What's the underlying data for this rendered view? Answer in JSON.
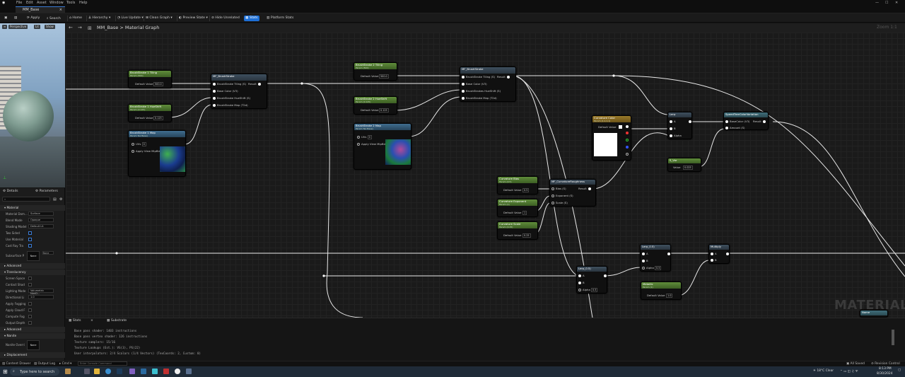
{
  "menu": [
    "File",
    "Edit",
    "Asset",
    "Window",
    "Tools",
    "Help"
  ],
  "tab": {
    "title": "MM_Base"
  },
  "toolbar": {
    "apply": "Apply",
    "search": "Search",
    "home": "Home",
    "hierarchy": "Hierarchy",
    "live_update": "Live Update",
    "clean_graph": "Clean Graph",
    "preview_state": "Preview State",
    "hide_unrelated": "Hide Unrelated",
    "stats": "Stats",
    "platform_stats": "Platform Stats"
  },
  "viewport": {
    "perspective": "Perspective",
    "lit": "Lit",
    "show": "Show"
  },
  "details": {
    "tab_details": "Details",
    "tab_parameters": "Parameters",
    "sections": {
      "material": "Material",
      "advanced": "Advanced",
      "translucency": "Translucency",
      "advanced2": "Advanced",
      "nanite": "Nanite",
      "displacement": "Displacement"
    },
    "rows": [
      {
        "label": "Material Dom...",
        "value": "Surface"
      },
      {
        "label": "Blend Mode",
        "value": "Opaque"
      },
      {
        "label": "Shading Model",
        "value": "Default Lit"
      },
      {
        "label": "Two Sided",
        "value": ""
      },
      {
        "label": "Use Material",
        "value": ""
      },
      {
        "label": "Cast Ray Tra",
        "value": ""
      }
    ],
    "subsurface_label": "Subsurface P",
    "none_label": "None",
    "trans_rows": [
      "Screen Space",
      "Contact Shad",
      "Lighting Mode",
      "Directional Li",
      "Apply Fogging",
      "Apply Cloud F",
      "Compute Fog",
      "Output Depth"
    ],
    "lighting_mode_value": "Volumetric NonD...",
    "directional_value": "1.0",
    "nanite_label": "Nanite Overri",
    "nanite_value": "None"
  },
  "graph": {
    "breadcrumb_root": "MM_Base",
    "breadcrumb_sep": ">",
    "breadcrumb_leaf": "Material Graph",
    "zoom": "Zoom 1:1",
    "watermark": "MATERIAL"
  },
  "nodes": {
    "bs1_tiling": {
      "title": "BrushStroke 1 Tiling",
      "sub": "Param (500)",
      "label": "Default Value",
      "value": "500.0"
    },
    "bs1_hueshift": {
      "title": "BrushStroke 1 HueShift",
      "sub": "Param (0.125)",
      "label": "Default Value",
      "value": "0.125"
    },
    "bs1_map": {
      "title": "BrushStroke 1 Map",
      "sub": "Param Tex Base)",
      "uvs": "UVs",
      "uvs_val": "0",
      "apply": "Apply View MipBias"
    },
    "mf_bs1": {
      "title": "MF_BrushStroke",
      "result": "Result",
      "pins": [
        "BrushStroke Tiling (S)",
        "Base Color (V3)",
        "BrushStroke HueShift (S)",
        "BrushStroke Map (T2d)"
      ]
    },
    "bs2_tiling": {
      "title": "BrushStroke 2 Tiling",
      "sub": "Param (500)",
      "label": "Default Value",
      "value": "500.0"
    },
    "bs2_hueshift": {
      "title": "BrushStroke 2 HueShift",
      "sub": "Param (0.125)",
      "label": "Default Value",
      "value": "0.125"
    },
    "bs2_map": {
      "title": "BrushStroke 2 Map",
      "sub": "Param Tex Base)",
      "uvs": "UVs",
      "uvs_val": "0",
      "apply": "Apply View MipBias"
    },
    "mf_bs2": {
      "title": "MF_BrushStroke",
      "result": "Result",
      "pins": [
        "BrushStroke Tiling (S)",
        "Base Color (V3)",
        "BrushStrokes HueShift (S)",
        "BrushStroke Map (T2d)"
      ]
    },
    "curv_color": {
      "title": "Curvature Color",
      "sub": "Param (1,1,1,1)",
      "label": "Default Value"
    },
    "lerp1": {
      "title": "Lerp",
      "a": "A",
      "b": "B",
      "alpha": "Alpha"
    },
    "speed_tree": {
      "title": "SpeedTreeColorVariation",
      "result": "Result",
      "base": "BaseColor (V3)",
      "amount": "Amount (S)"
    },
    "s_param": {
      "title": "S_Var",
      "label": "Value",
      "value": "0.025"
    },
    "curv_bias": {
      "title": "Curvature Bias",
      "sub": "Param (0.5)",
      "label": "Default Value",
      "value": "0.5"
    },
    "curv_exp": {
      "title": "Curvature Exponent",
      "sub": "Param (1)",
      "label": "Default Value",
      "value": "1"
    },
    "curv_scale": {
      "title": "Curvature Scale",
      "sub": "Param (0.25)",
      "label": "Default Value",
      "value": "0.25"
    },
    "mf_curv": {
      "title": "MF_CurvatureRoughness",
      "result": "Result",
      "pins": [
        "Bias (S)",
        "Exponent (S)",
        "Scale (S)"
      ]
    },
    "lerp2": {
      "title": "Lerp_0.5)",
      "a": "A",
      "b": "B",
      "alpha": "Alpha",
      "alpha_val": "0.5"
    },
    "lerp3": {
      "title": "Lerp_0.5)",
      "a": "A",
      "b": "B",
      "alpha": "Alpha",
      "alpha_val": "0.5"
    },
    "multiply": {
      "title": "Multiply",
      "a": "A",
      "b": "B"
    },
    "metallic": {
      "title": "Metallic",
      "sub": "Param (1)",
      "label": "Default Value",
      "value": "1.0"
    },
    "corner": {
      "title": "Name"
    }
  },
  "stats": {
    "tab_stats": "Stats",
    "tab_substrate": "Substrate",
    "lines": [
      "Base pass shader: 1403 instructions",
      "Base pass vertex shader: 126 instructions",
      "Texture samplers: 15/16",
      "Texture Lookups (Est.): VS(3), PS(22)",
      "User interpolators: 2/4 Scalars (1/4 Vectors) (TexCoords: 2, Custom: 0)"
    ]
  },
  "bottom": {
    "content_drawer": "Content Drawer",
    "output_log": "Output Log",
    "cmd": "Cmd",
    "cmd_placeholder": "Enter Console Command",
    "all_saved": "All Saved",
    "revision": "Revision Control"
  },
  "taskbar": {
    "search": "Type here to search",
    "weather": "18°C  Clear",
    "time": "8:13 PM",
    "date": "8/30/2024"
  }
}
